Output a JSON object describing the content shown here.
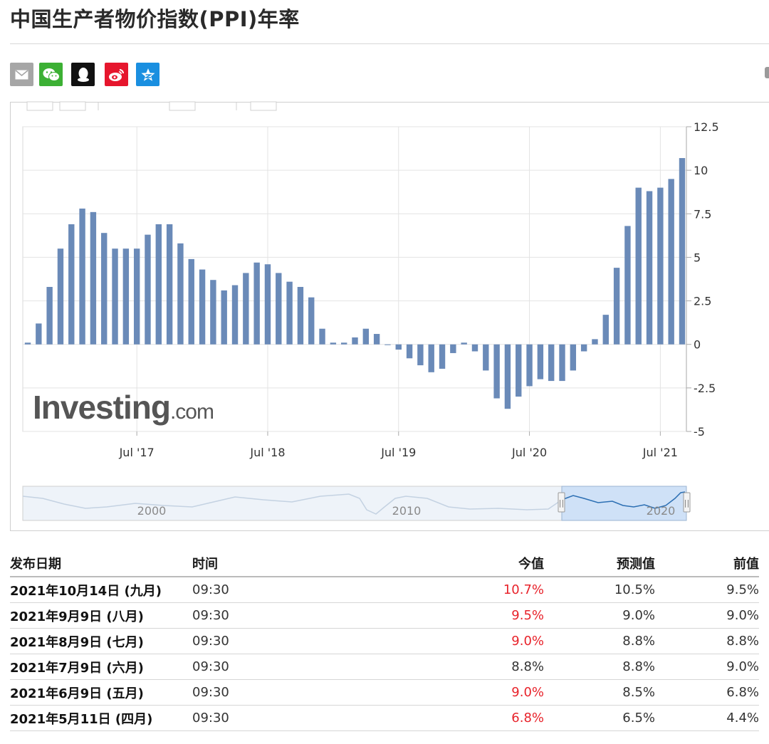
{
  "page": {
    "title": "中国生产者物价指数(PPI)年率"
  },
  "share": {
    "buttons": [
      {
        "name": "email",
        "icon": "email-icon",
        "color": "#a6a6a6"
      },
      {
        "name": "wechat",
        "icon": "wechat-icon",
        "color": "#3cb034"
      },
      {
        "name": "qq",
        "icon": "qq-icon",
        "color": "#111111"
      },
      {
        "name": "weibo",
        "icon": "weibo-icon",
        "color": "#e6162d"
      },
      {
        "name": "qzone",
        "icon": "qzone-icon",
        "color": "#1a8fe0"
      }
    ]
  },
  "chart_data": {
    "type": "bar",
    "title": "",
    "xlabel": "",
    "ylabel": "",
    "ylim": [
      -5,
      12.5
    ],
    "y_ticks": [
      12.5,
      10,
      7.5,
      5,
      2.5,
      0,
      -2.5,
      -5
    ],
    "y_tick_labels": [
      "12.5",
      "10",
      "7.5",
      "5",
      "2.5",
      "0",
      "-2.5",
      "-5"
    ],
    "x_tick_labels": [
      "Jul '17",
      "Jul '18",
      "Jul '19",
      "Jul '20",
      "Jul '21"
    ],
    "x_tick_months": [
      "2017-07",
      "2018-07",
      "2019-07",
      "2020-07",
      "2021-07"
    ],
    "grid": true,
    "bar_color": "#6a8ab8",
    "watermark": {
      "brand": "Investing",
      "suffix": ".com"
    },
    "months": [
      "2016-09",
      "2016-10",
      "2016-11",
      "2016-12",
      "2017-01",
      "2017-02",
      "2017-03",
      "2017-04",
      "2017-05",
      "2017-06",
      "2017-07",
      "2017-08",
      "2017-09",
      "2017-10",
      "2017-11",
      "2017-12",
      "2018-01",
      "2018-02",
      "2018-03",
      "2018-04",
      "2018-05",
      "2018-06",
      "2018-07",
      "2018-08",
      "2018-09",
      "2018-10",
      "2018-11",
      "2018-12",
      "2019-01",
      "2019-02",
      "2019-03",
      "2019-04",
      "2019-05",
      "2019-06",
      "2019-07",
      "2019-08",
      "2019-09",
      "2019-10",
      "2019-11",
      "2019-12",
      "2020-01",
      "2020-02",
      "2020-03",
      "2020-04",
      "2020-05",
      "2020-06",
      "2020-07",
      "2020-08",
      "2020-09",
      "2020-10",
      "2020-11",
      "2020-12",
      "2021-01",
      "2021-02",
      "2021-03",
      "2021-04",
      "2021-05",
      "2021-06",
      "2021-07",
      "2021-08",
      "2021-09"
    ],
    "values": [
      0.1,
      1.2,
      3.3,
      5.5,
      6.9,
      7.8,
      7.6,
      6.4,
      5.5,
      5.5,
      5.5,
      6.3,
      6.9,
      6.9,
      5.8,
      4.9,
      4.3,
      3.7,
      3.1,
      3.4,
      4.1,
      4.7,
      4.6,
      4.1,
      3.6,
      3.3,
      2.7,
      0.9,
      0.1,
      0.1,
      0.4,
      0.9,
      0.6,
      0.0,
      -0.3,
      -0.8,
      -1.2,
      -1.6,
      -1.4,
      -0.5,
      0.1,
      -0.4,
      -1.5,
      -3.1,
      -3.7,
      -3.0,
      -2.4,
      -2.0,
      -2.1,
      -2.1,
      -1.5,
      -0.4,
      0.3,
      1.7,
      4.4,
      6.8,
      9.0,
      8.8,
      9.0,
      9.5,
      10.7
    ]
  },
  "navigator": {
    "labels": [
      "2000",
      "2010",
      "2020"
    ],
    "handle_glyph": "||"
  },
  "table": {
    "headers": [
      "发布日期",
      "时间",
      "今值",
      "预测值",
      "前值"
    ],
    "rows": [
      {
        "date": "2021年10月14日 (九月)",
        "time": "09:30",
        "actual": "10.7%",
        "forecast": "10.5%",
        "previous": "9.5%",
        "actual_hot": true
      },
      {
        "date": "2021年9月9日 (八月)",
        "time": "09:30",
        "actual": "9.5%",
        "forecast": "9.0%",
        "previous": "9.0%",
        "actual_hot": true
      },
      {
        "date": "2021年8月9日 (七月)",
        "time": "09:30",
        "actual": "9.0%",
        "forecast": "8.8%",
        "previous": "8.8%",
        "actual_hot": true
      },
      {
        "date": "2021年7月9日 (六月)",
        "time": "09:30",
        "actual": "8.8%",
        "forecast": "8.8%",
        "previous": "9.0%",
        "actual_hot": false
      },
      {
        "date": "2021年6月9日 (五月)",
        "time": "09:30",
        "actual": "9.0%",
        "forecast": "8.5%",
        "previous": "6.8%",
        "actual_hot": true
      },
      {
        "date": "2021年5月11日 (四月)",
        "time": "09:30",
        "actual": "6.8%",
        "forecast": "6.5%",
        "previous": "4.4%",
        "actual_hot": true
      }
    ]
  }
}
